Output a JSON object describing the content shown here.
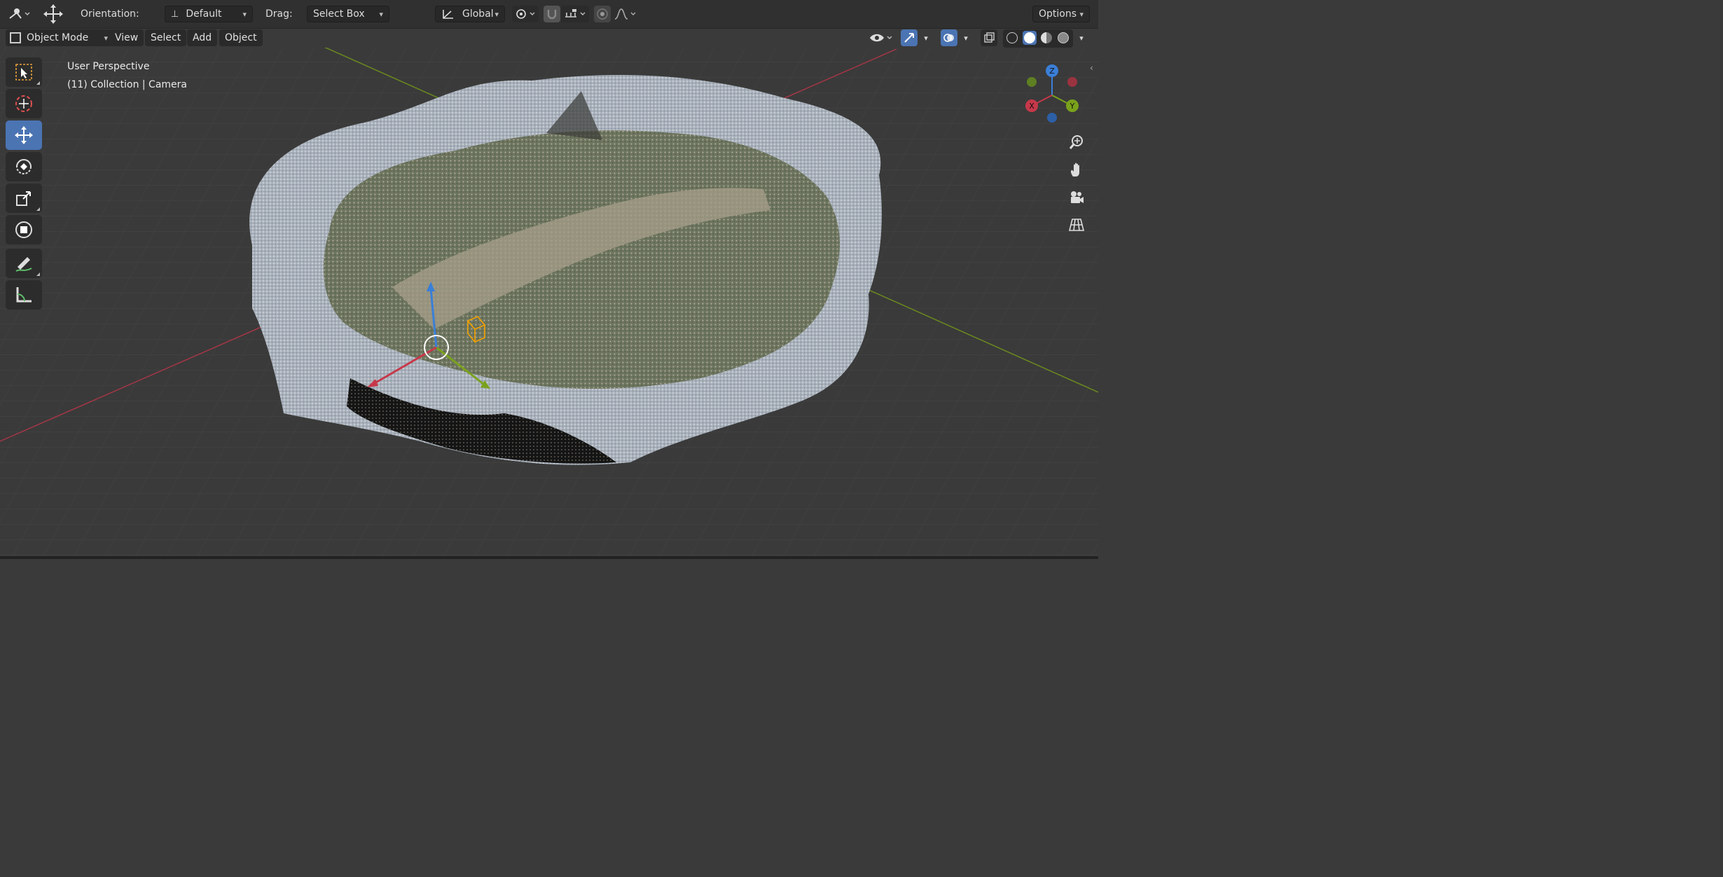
{
  "topbar": {
    "orientation_label": "Orientation:",
    "orientation_value": "Default",
    "drag_label": "Drag:",
    "drag_value": "Select Box",
    "transform_space": "Global",
    "options_label": "Options"
  },
  "header": {
    "mode": "Object Mode",
    "menus": [
      "View",
      "Select",
      "Add",
      "Object"
    ]
  },
  "viewport": {
    "perspective": "User Perspective",
    "collection": "(11) Collection | Camera"
  },
  "gizmo": {
    "z": "Z",
    "x": "X",
    "y": "Y"
  },
  "colors": {
    "x_axis": "#c6384a",
    "y_axis": "#7aa21c",
    "z_axis": "#3a7fd8",
    "active_tool": "#4b74b3",
    "bg": "#3a3a3a"
  },
  "tools": [
    "select-box-icon",
    "cursor-icon",
    "move-icon",
    "rotate-icon",
    "scale-icon",
    "transform-icon",
    "annotate-icon",
    "measure-icon"
  ],
  "nav_buttons": [
    "zoom-icon",
    "hand-icon",
    "camera-icon",
    "grid-icon"
  ]
}
